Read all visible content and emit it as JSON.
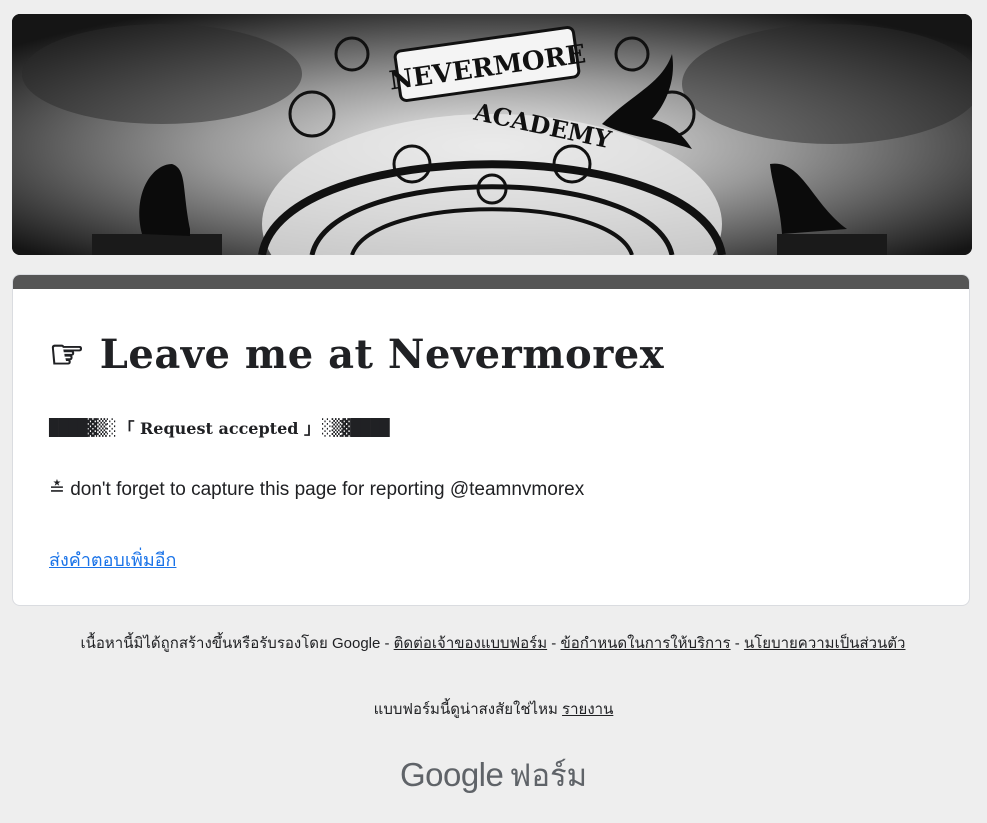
{
  "header": {
    "banner_alt": "Nevermore Academy gate banner"
  },
  "confirmation": {
    "title_icon": "☞",
    "title": "Leave me at Nevermorex",
    "status_left_bars": "████▓▒░",
    "status_text": "「 Request accepted 」",
    "status_right_bars": "░▒▓████",
    "note_icon": "≛",
    "note": "don't forget to capture this page for reporting @teamnvmorex",
    "resubmit_link": "ส่งคำตอบเพิ่มอีก"
  },
  "footer": {
    "disclaimer": "เนื้อหานี้มิได้ถูกสร้างขึ้นหรือรับรองโดย Google -",
    "sep": "-",
    "contact_link": "ติดต่อเจ้าของแบบฟอร์ม",
    "terms_link": "ข้อกำหนดในการให้บริการ",
    "privacy_link": "นโยบายความเป็นส่วนตัว",
    "suspicious_text": "แบบฟอร์มนี้ดูน่าสงสัยใช่ไหม",
    "report_link": "รายงาน",
    "logo_google": "Google",
    "logo_forms": "ฟอร์ม"
  },
  "colors": {
    "page_bg": "#eeeeee",
    "card_bar": "#555555",
    "link_blue": "#1a73e8"
  }
}
